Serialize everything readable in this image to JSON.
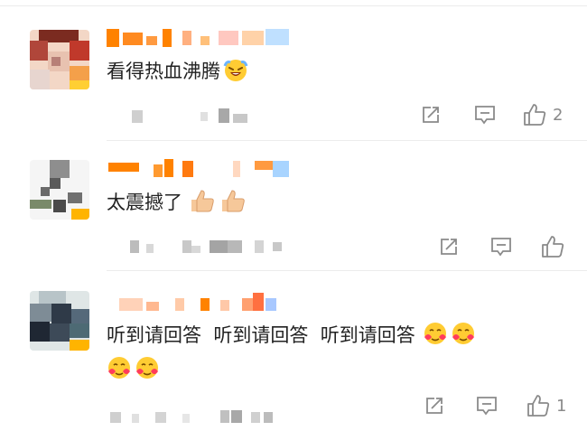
{
  "comments": [
    {
      "text": "看得热血沸腾",
      "emojis": [
        "grinning-sweat-emoji"
      ],
      "like_count": "2",
      "has_like_count": true
    },
    {
      "text": "太震撼了",
      "emojis": [
        "thumbs-up-emoji",
        "thumbs-up-emoji"
      ],
      "like_count": "",
      "has_like_count": false
    },
    {
      "text": "听到请回答  听到请回答  听到请回答",
      "emojis": [
        "heart-hug-emoji",
        "heart-hug-emoji",
        "heart-hug-emoji",
        "heart-hug-emoji"
      ],
      "like_count": "1",
      "has_like_count": true
    }
  ],
  "icons": {
    "share": "share-icon",
    "reply": "comment-icon",
    "like": "thumbs-up-icon"
  },
  "colors": {
    "username_orange": "#ff8200",
    "icon_gray": "#8a8a8a",
    "divider": "#ececec"
  }
}
